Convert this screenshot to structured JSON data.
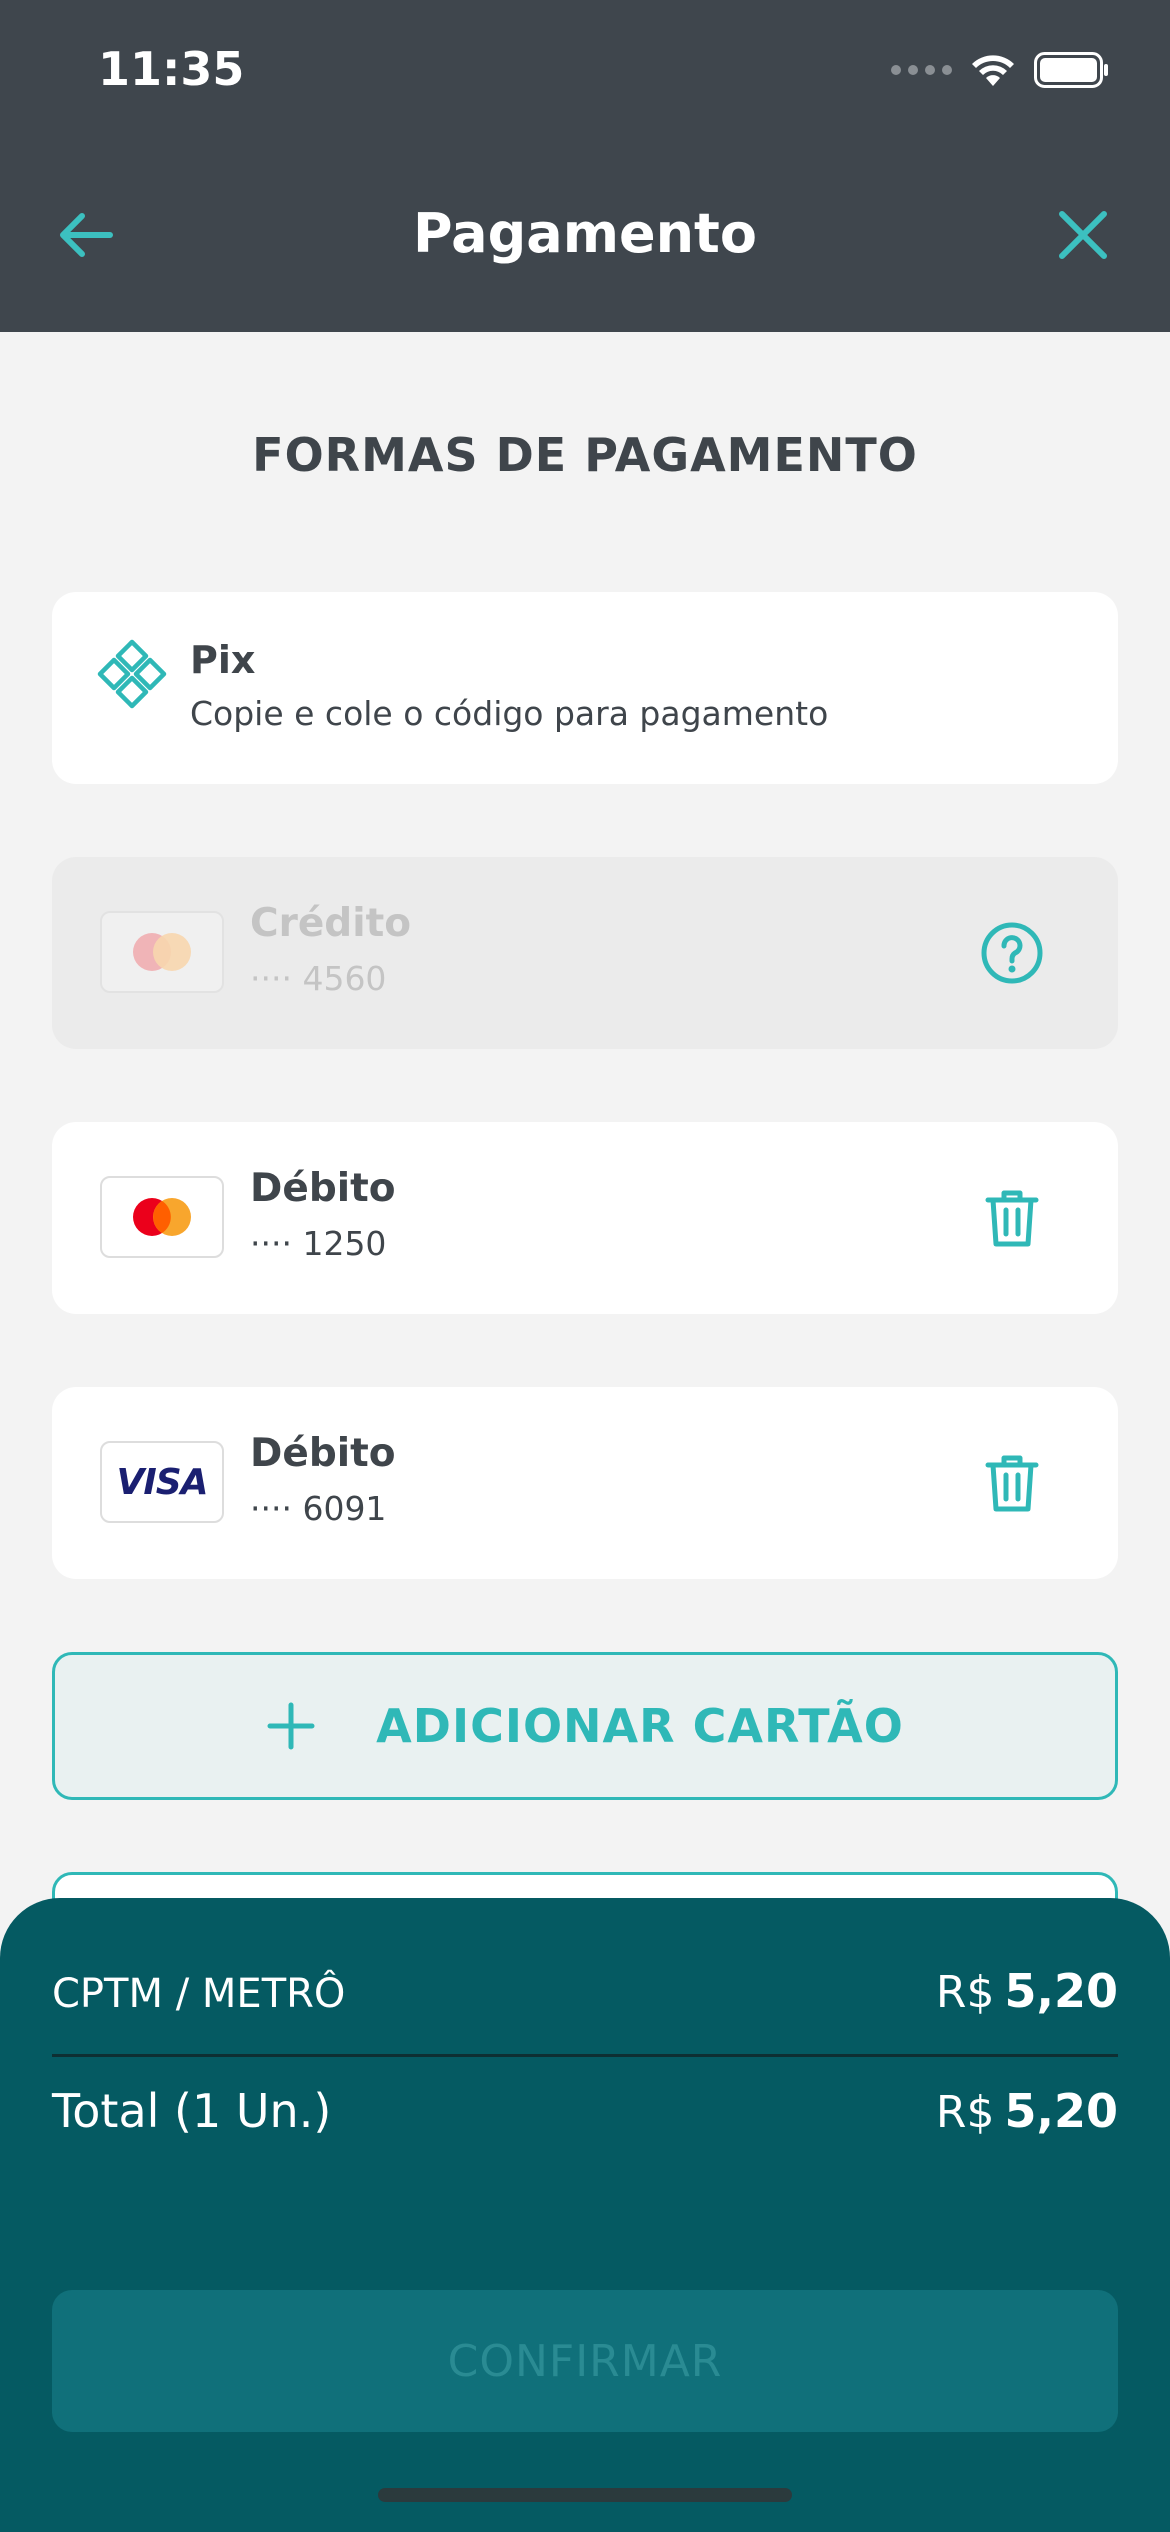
{
  "status_bar": {
    "time": "11:35"
  },
  "header": {
    "title": "Pagamento"
  },
  "section_title": "FORMAS DE PAGAMENTO",
  "pix": {
    "title": "Pix",
    "subtitle": "Copie e cole o código para pagamento"
  },
  "cards": [
    {
      "type": "Crédito",
      "number": "···· 4560",
      "brand": "mastercard",
      "disabled": true,
      "action": "help-icon"
    },
    {
      "type": "Débito",
      "number": "···· 1250",
      "brand": "mastercard",
      "disabled": false,
      "action": "trash-icon"
    },
    {
      "type": "Débito",
      "number": "···· 6091",
      "brand": "visa",
      "brand_text": "VISA",
      "disabled": false,
      "action": "trash-icon"
    }
  ],
  "add_card_label": "ADICIONAR CARTÃO",
  "summary": {
    "item_label": "CPTM / METRÔ",
    "item_currency": "R$",
    "item_amount": "5,20",
    "total_label": "Total (1 Un.)",
    "total_currency": "R$",
    "total_amount": "5,20"
  },
  "confirm_label": "CONFIRMAR",
  "colors": {
    "accent": "#2fb8b7",
    "header_bg": "#3f464d",
    "sheet_bg": "#055a62"
  }
}
